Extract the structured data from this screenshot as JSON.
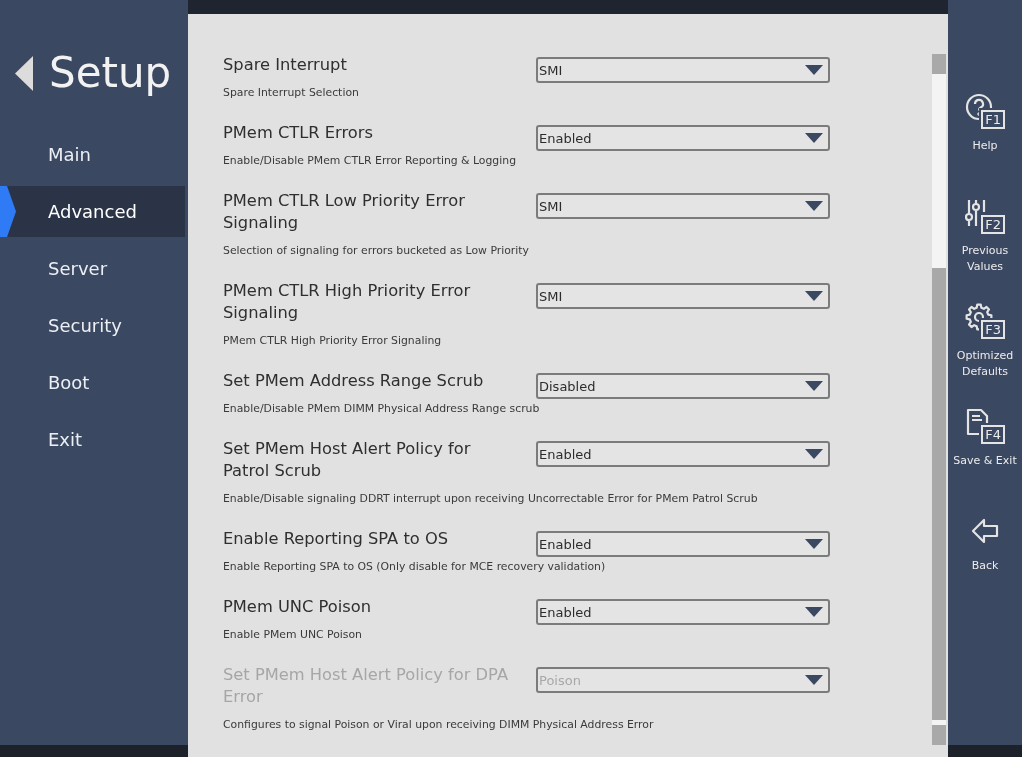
{
  "sidebar": {
    "title": "Setup",
    "items": [
      {
        "label": "Main",
        "selected": false
      },
      {
        "label": "Advanced",
        "selected": true
      },
      {
        "label": "Server",
        "selected": false
      },
      {
        "label": "Security",
        "selected": false
      },
      {
        "label": "Boot",
        "selected": false
      },
      {
        "label": "Exit",
        "selected": false
      }
    ]
  },
  "settings": [
    {
      "label": "Spare Interrupt",
      "value": "SMI",
      "help": "Spare Interrupt Selection",
      "disabled": false
    },
    {
      "label": "PMem CTLR Errors",
      "value": "Enabled",
      "help": "Enable/Disable PMem CTLR Error Reporting & Logging",
      "disabled": false
    },
    {
      "label": "PMem CTLR Low Priority Error Signaling",
      "value": "SMI",
      "help": "Selection of signaling for errors bucketed as Low Priority",
      "disabled": false
    },
    {
      "label": "PMem CTLR High Priority Error Signaling",
      "value": "SMI",
      "help": "PMem CTLR High Priority Error Signaling",
      "disabled": false
    },
    {
      "label": "Set PMem Address Range Scrub",
      "value": "Disabled",
      "help": "Enable/Disable PMem DIMM Physical Address Range scrub",
      "disabled": false
    },
    {
      "label": "Set PMem Host Alert Policy for Patrol Scrub",
      "value": "Enabled",
      "help": "Enable/Disable signaling DDRT interrupt upon receiving Uncorrectable Error for PMem Patrol Scrub",
      "disabled": false
    },
    {
      "label": "Enable Reporting SPA to OS",
      "value": "Enabled",
      "help": "Enable Reporting SPA to OS (Only disable for MCE recovery validation)",
      "disabled": false
    },
    {
      "label": "PMem UNC Poison",
      "value": "Enabled",
      "help": "Enable PMem UNC Poison",
      "disabled": false
    },
    {
      "label": "Set PMem Host Alert Policy for DPA Error",
      "value": "Poison",
      "help": "Configures to signal Poison or Viral upon receiving DIMM Physical Address Error",
      "disabled": true
    }
  ],
  "actions": [
    {
      "kind": "help",
      "label": "Help",
      "key": "F1"
    },
    {
      "kind": "restore",
      "label": "Previous Values",
      "key": "F2"
    },
    {
      "kind": "defaults",
      "label": "Optimized Defaults",
      "key": "F3"
    },
    {
      "kind": "save",
      "label": "Save & Exit",
      "key": "F4"
    },
    {
      "kind": "back",
      "label": "Back"
    }
  ]
}
